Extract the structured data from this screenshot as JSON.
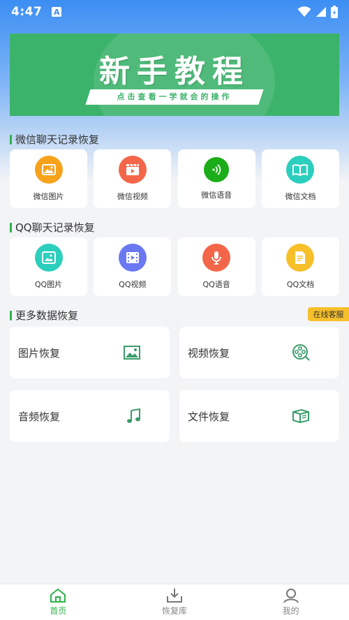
{
  "status": {
    "time": "4:47",
    "badge": "A"
  },
  "banner": {
    "title": "新手教程",
    "subtitle": "点击查看一学就会的操作"
  },
  "wechat": {
    "title": "微信聊天记录恢复",
    "items": [
      {
        "label": "微信图片",
        "icon": "image-icon",
        "color": "#f7a21b"
      },
      {
        "label": "微信视频",
        "icon": "video-clapper-icon",
        "color": "#f4664a"
      },
      {
        "label": "微信语音",
        "icon": "voice-icon",
        "color": "#1aad19"
      },
      {
        "label": "微信文档",
        "icon": "book-icon",
        "color": "#2ccfbd"
      }
    ]
  },
  "qq": {
    "title": "QQ聊天记录恢复",
    "items": [
      {
        "label": "QQ图片",
        "icon": "image-icon",
        "color": "#2ccfbd"
      },
      {
        "label": "QQ视频",
        "icon": "film-icon",
        "color": "#6a79f2"
      },
      {
        "label": "QQ语音",
        "icon": "microphone-icon",
        "color": "#f4664a"
      },
      {
        "label": "QQ文档",
        "icon": "document-icon",
        "color": "#f7c02a"
      }
    ]
  },
  "more": {
    "title": "更多数据恢复",
    "service_label": "在线客服",
    "items": [
      {
        "label": "图片恢复",
        "icon": "picture-icon"
      },
      {
        "label": "视频恢复",
        "icon": "film-reel-icon"
      },
      {
        "label": "音频恢复",
        "icon": "music-note-icon"
      },
      {
        "label": "文件恢复",
        "icon": "file-box-icon"
      }
    ]
  },
  "nav": {
    "items": [
      {
        "label": "首页",
        "icon": "home-icon",
        "active": true
      },
      {
        "label": "恢复库",
        "icon": "download-tray-icon",
        "active": false
      },
      {
        "label": "我的",
        "icon": "user-icon",
        "active": false
      }
    ]
  },
  "colors": {
    "accent": "#2db34a",
    "banner": "#3bb36b",
    "service_badge": "#f7c02a"
  }
}
